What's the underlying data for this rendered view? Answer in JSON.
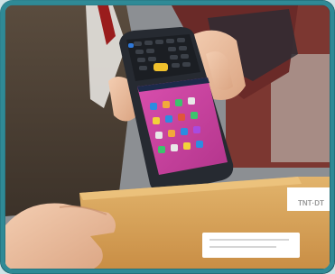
{
  "photo": {
    "subject": "handheld-barcode-scanner-handover",
    "parcel_label_visible_text": "TNT·DT",
    "colors": {
      "frame_teal": "#1f6f7a",
      "envelope": "#d8a45a",
      "device_body": "#262a31",
      "screen_bg": "#c9439c",
      "scan_button": "#f0c12c",
      "uniform": "#4b3f33",
      "jacket": "#5a2a24"
    }
  }
}
